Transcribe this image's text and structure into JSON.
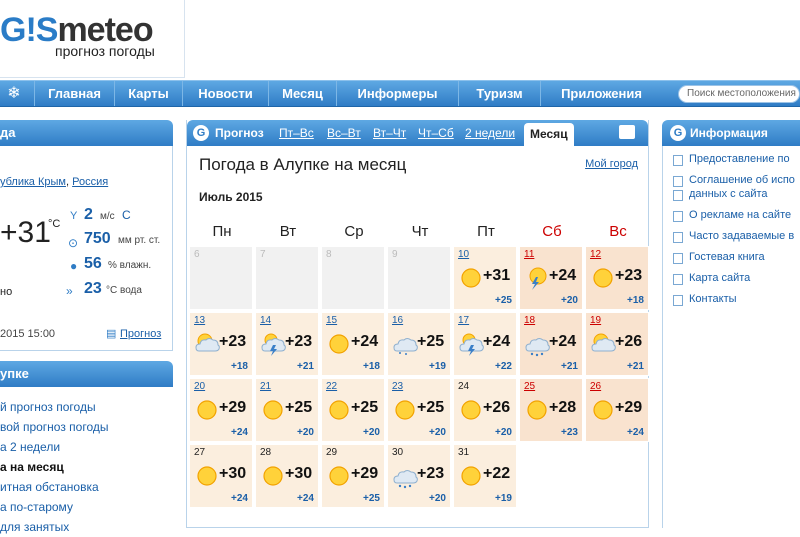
{
  "logo": {
    "part1": "G",
    "part2": "!S",
    "part3": "meteo",
    "subtitle": "прогноз погоды"
  },
  "nav": {
    "items": [
      "Главная",
      "Карты",
      "Новости",
      "Месяц",
      "Информеры",
      "Туризм",
      "Приложения"
    ],
    "search_placeholder": "Поиск местоположения"
  },
  "left": {
    "header": "да",
    "region_part": "убликa Крым",
    "country": "Россия",
    "temp": "+31",
    "temp_unit": "°C",
    "wind_value": "2",
    "wind_unit": "м/с",
    "wind_dir": "С",
    "pressure_value": "750",
    "pressure_unit": "мм рт. ст.",
    "humidity_value": "56",
    "humidity_unit": "% влажн.",
    "water_value": "23",
    "water_unit": "°С вода",
    "side_text": "но",
    "updated": "2015 15:00",
    "forecast_link": "Прогноз",
    "menu_header": "упке",
    "menu": [
      "й прогноз погоды",
      "вой прогноз погоды",
      "а 2 недели",
      "а на месяц",
      "итная обстановка",
      "а по-старому",
      "для занятых"
    ]
  },
  "center": {
    "tabs": [
      "Прогноз",
      "Пт–Вс",
      "Вс–Вт",
      "Вт–Чт",
      "Чт–Сб",
      "2 недели",
      "Месяц"
    ],
    "title": "Погода в Алупке на месяц",
    "my_city": "Мой город",
    "month": "Июль 2015",
    "weekdays": [
      "Пн",
      "Вт",
      "Ср",
      "Чт",
      "Пт",
      "Сб",
      "Вс"
    ],
    "days": [
      {
        "d": "6",
        "past": true
      },
      {
        "d": "7",
        "past": true
      },
      {
        "d": "8",
        "past": true
      },
      {
        "d": "9",
        "past": true
      },
      {
        "d": "10",
        "t": "+31",
        "n": "+25",
        "icon": "sun"
      },
      {
        "d": "11",
        "t": "+24",
        "n": "+20",
        "icon": "storm-sun"
      },
      {
        "d": "12",
        "t": "+23",
        "n": "+18",
        "icon": "sun"
      },
      {
        "d": "13",
        "t": "+23",
        "n": "+18",
        "icon": "partly-cloudy"
      },
      {
        "d": "14",
        "t": "+23",
        "n": "+21",
        "icon": "storm-cloud"
      },
      {
        "d": "15",
        "t": "+24",
        "n": "+18",
        "icon": "sun"
      },
      {
        "d": "16",
        "t": "+25",
        "n": "+19",
        "icon": "cloudy"
      },
      {
        "d": "17",
        "t": "+24",
        "n": "+22",
        "icon": "storm-cloud"
      },
      {
        "d": "18",
        "t": "+24",
        "n": "+21",
        "icon": "rain-cloud"
      },
      {
        "d": "19",
        "t": "+26",
        "n": "+21",
        "icon": "partly-cloudy"
      },
      {
        "d": "20",
        "t": "+29",
        "n": "+24",
        "icon": "sun"
      },
      {
        "d": "21",
        "t": "+25",
        "n": "+20",
        "icon": "sun"
      },
      {
        "d": "22",
        "t": "+25",
        "n": "+20",
        "icon": "sun"
      },
      {
        "d": "23",
        "t": "+25",
        "n": "+20",
        "icon": "sun"
      },
      {
        "d": "24",
        "t": "+26",
        "n": "+20",
        "icon": "sun"
      },
      {
        "d": "25",
        "t": "+28",
        "n": "+23",
        "icon": "sun"
      },
      {
        "d": "26",
        "t": "+29",
        "n": "+24",
        "icon": "sun"
      },
      {
        "d": "27",
        "t": "+30",
        "n": "+24",
        "icon": "sun"
      },
      {
        "d": "28",
        "t": "+30",
        "n": "+24",
        "icon": "sun"
      },
      {
        "d": "29",
        "t": "+29",
        "n": "+25",
        "icon": "sun"
      },
      {
        "d": "30",
        "t": "+23",
        "n": "+20",
        "icon": "rain-cloud"
      },
      {
        "d": "31",
        "t": "+22",
        "n": "+19",
        "icon": "sun"
      }
    ]
  },
  "right": {
    "header": "Информация",
    "links": [
      "Предоставление по",
      "Соглашение об испо",
      "данных с сайта",
      "О рекламе на сайте",
      "Часто задаваемые в",
      "Гостевая книга",
      "Карта сайта",
      "Контакты"
    ]
  },
  "colors": {
    "accent": "#2f7cc5",
    "link": "#1a5fa8",
    "weekend": "#cc0000",
    "cell": "#fbeede"
  }
}
